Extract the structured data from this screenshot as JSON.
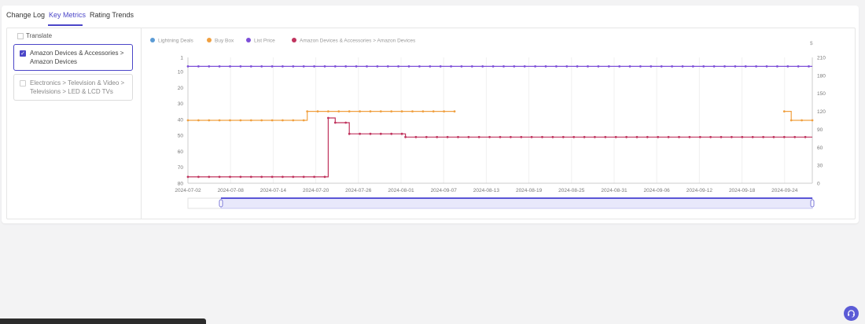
{
  "tabs": [
    {
      "label": "Change Log",
      "active": false
    },
    {
      "label": "Key Metrics",
      "active": true
    },
    {
      "label": "Rating Trends",
      "active": false
    }
  ],
  "left_panel": {
    "translate_label": "Translate",
    "categories": [
      {
        "label": "Amazon Devices & Accessories > Amazon Devices",
        "checked": true
      },
      {
        "label": "Electronics > Television & Video > Televisions > LED & LCD TVs",
        "checked": false
      }
    ]
  },
  "colors": {
    "accent": "#4b46c8",
    "lightning_deals": "#5b9bd5",
    "buy_box": "#f0a040",
    "list_price": "#7d4fd8",
    "category_rank": "#c0345e"
  },
  "chart_data": {
    "type": "line",
    "title": "",
    "legend": [
      "Lightning Deals",
      "Buy Box",
      "List Price",
      "Amazon Devices & Accessories > Amazon Devices"
    ],
    "legend_placement": "top-left",
    "x_ticks": [
      "2024-07-02",
      "2024-07-08",
      "2024-07-14",
      "2024-07-20",
      "2024-07-26",
      "2024-08-01",
      "2024-09-07",
      "2024-08-13",
      "2024-08-19",
      "2024-08-25",
      "2024-08-31",
      "2024-09-06",
      "2024-09-12",
      "2024-09-18",
      "2024-09-24"
    ],
    "left_axis": {
      "ticks": [
        1,
        10,
        20,
        30,
        40,
        50,
        60,
        70,
        80
      ],
      "range": [
        1,
        80
      ],
      "inverted": true
    },
    "right_axis": {
      "ticks": [
        0,
        30,
        60,
        90,
        120,
        150,
        180,
        210
      ],
      "range": [
        0,
        210
      ],
      "top_label": "$"
    },
    "x_range": [
      "2024-07-02",
      "2024-09-29"
    ],
    "grid": true,
    "series": [
      {
        "name": "List Price",
        "axis": "right",
        "step": true,
        "points": [
          [
            "2024-07-02",
            195
          ],
          [
            "2024-09-29",
            195
          ]
        ]
      },
      {
        "name": "Buy Box",
        "axis": "right",
        "step": true,
        "segments": [
          [
            [
              "2024-07-02",
              105
            ],
            [
              "2024-07-19",
              105
            ],
            [
              "2024-07-19",
              120
            ],
            [
              "2024-08-09",
              120
            ]
          ],
          [
            [
              "2024-09-25",
              120
            ],
            [
              "2024-09-26",
              120
            ],
            [
              "2024-09-26",
              105
            ],
            [
              "2024-09-29",
              105
            ]
          ]
        ]
      },
      {
        "name": "Amazon Devices & Accessories > Amazon Devices",
        "axis": "left",
        "step": true,
        "points": [
          [
            "2024-07-02",
            76
          ],
          [
            "2024-07-22",
            76
          ],
          [
            "2024-07-22",
            39
          ],
          [
            "2024-07-23",
            39
          ],
          [
            "2024-07-23",
            42
          ],
          [
            "2024-07-25",
            42
          ],
          [
            "2024-07-25",
            49
          ],
          [
            "2024-08-02",
            49
          ],
          [
            "2024-08-02",
            51
          ],
          [
            "2024-09-29",
            51
          ]
        ]
      }
    ]
  }
}
